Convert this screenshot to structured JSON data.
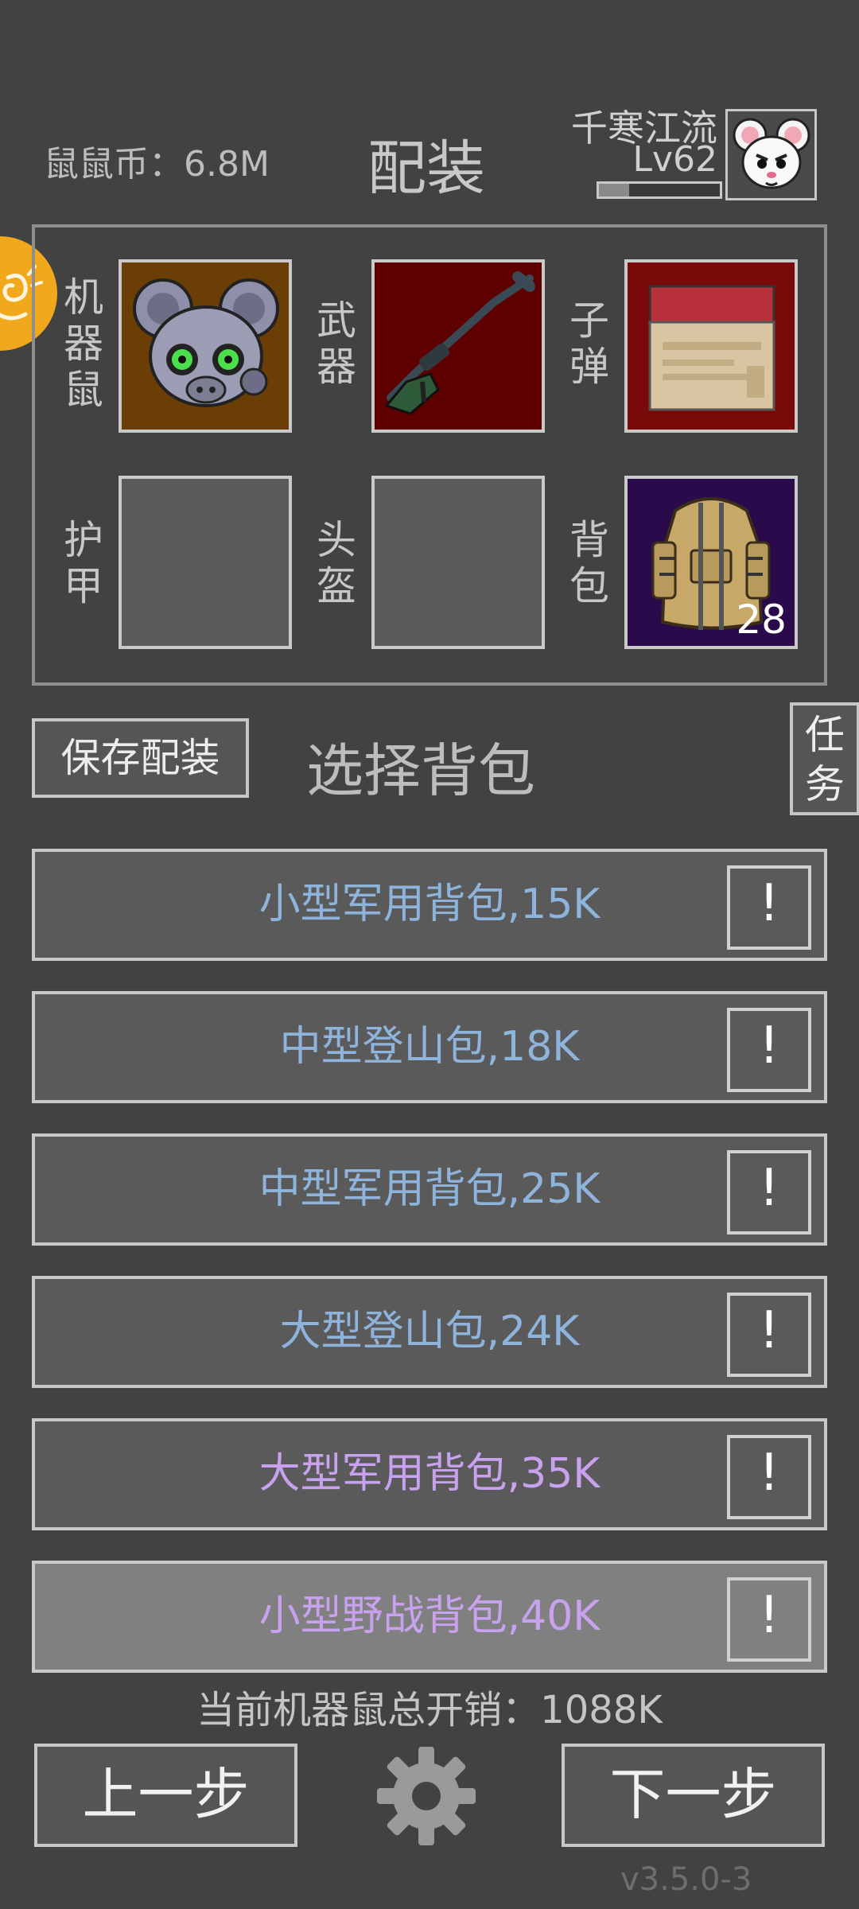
{
  "header": {
    "coin_text": "鼠鼠币：6.8M",
    "title": "配装",
    "player_name": "千寒江流",
    "player_level": "Lv62",
    "xp_fraction": 0.25
  },
  "equipment": {
    "slots": [
      {
        "label": "机器鼠",
        "item": "robot-mouse-icon",
        "bg": "#6b3e05"
      },
      {
        "label": "武器",
        "item": "sniper-rifle-icon",
        "bg": "#5e0000"
      },
      {
        "label": "子弹",
        "item": "ammo-box-icon",
        "bg": "#7a0a0a"
      },
      {
        "label": "护甲",
        "item": "",
        "bg": "#5b5b5b"
      },
      {
        "label": "头盔",
        "item": "",
        "bg": "#5b5b5b"
      },
      {
        "label": "背包",
        "item": "backpack-icon",
        "bg": "#2a0a4a",
        "badge": "28"
      }
    ]
  },
  "actions": {
    "save_label": "保存配装",
    "section_title": "选择背包",
    "task_label": "任务"
  },
  "backpacks": [
    {
      "label": "小型军用背包,15K",
      "color": "#8fb4dc",
      "selected": false
    },
    {
      "label": "中型登山包,18K",
      "color": "#8fb4dc",
      "selected": false
    },
    {
      "label": "中型军用背包,25K",
      "color": "#8fb4dc",
      "selected": false
    },
    {
      "label": "大型登山包,24K",
      "color": "#8fb4dc",
      "selected": false
    },
    {
      "label": "大型军用背包,35K",
      "color": "#c8a2ee",
      "selected": false
    },
    {
      "label": "小型野战背包,40K",
      "color": "#c8a2ee",
      "selected": true
    }
  ],
  "info_symbol": "!",
  "footer": {
    "total_cost": "当前机器鼠总开销：1088K",
    "prev_label": "上一步",
    "next_label": "下一步",
    "version": "v3.5.0-3"
  }
}
